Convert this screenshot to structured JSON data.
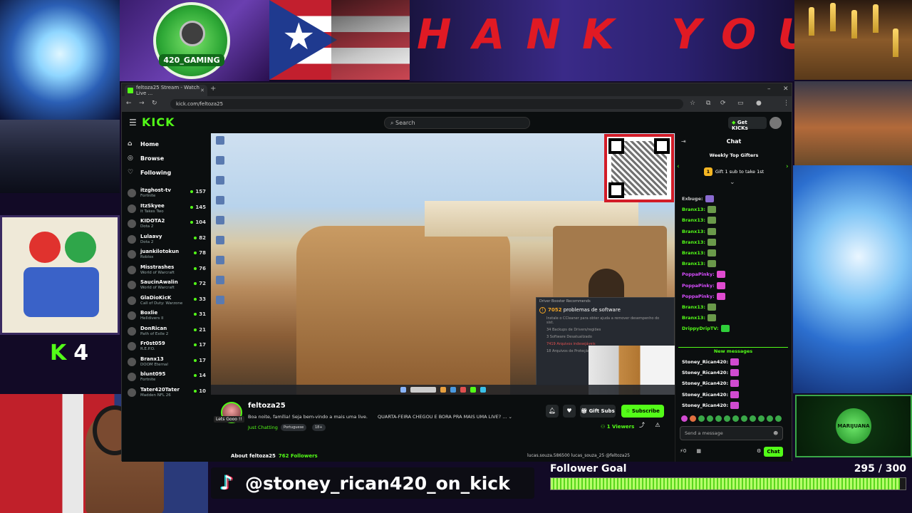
{
  "overlay": {
    "logo_text": "420_GAMING",
    "banner_text": "HANK YOU GUY",
    "kick_count_logo": "K",
    "kick_count": "4",
    "mj_text": "MARIJUANA",
    "tiktok_handle": "@stoney_rican420_on_kick",
    "follower_goal_label": "Follower Goal",
    "follower_goal_count": "295 / 300",
    "follower_goal_current": 295,
    "follower_goal_target": 300
  },
  "browser": {
    "tab_title": "feltoza25 Stream - Watch Live ...",
    "new_tab": "+",
    "url": "kick.com/feltoza25"
  },
  "kick": {
    "logo": "KICK",
    "search_placeholder": "Search",
    "get_kicks": "Get KICKs",
    "nav": [
      {
        "label": "Home",
        "icon": "home-icon"
      },
      {
        "label": "Browse",
        "icon": "browse-icon"
      },
      {
        "label": "Following",
        "icon": "heart-icon"
      }
    ],
    "following": [
      {
        "name": "itzghost-tv",
        "game": "Fortnite",
        "viewers": "157"
      },
      {
        "name": "ItzSkyee",
        "game": "It Takes Two",
        "viewers": "145"
      },
      {
        "name": "KIDOTA2",
        "game": "Dota 2",
        "viewers": "104"
      },
      {
        "name": "Lulaavy",
        "game": "Dota 2",
        "viewers": "82"
      },
      {
        "name": "juankilotokun",
        "game": "Roblox",
        "viewers": "78"
      },
      {
        "name": "Misstrashes",
        "game": "World of Warcraft",
        "viewers": "76"
      },
      {
        "name": "SaucinAwalin",
        "game": "World of Warcraft",
        "viewers": "72"
      },
      {
        "name": "GlaDioKicK",
        "game": "Call of Duty: Warzone",
        "viewers": "33"
      },
      {
        "name": "Boxlie",
        "game": "Helldivers II",
        "viewers": "31"
      },
      {
        "name": "DonRican",
        "game": "Path of Exile 2",
        "viewers": "21"
      },
      {
        "name": "Fr0st059",
        "game": "R.E.P.O.",
        "viewers": "17"
      },
      {
        "name": "Branx13",
        "game": "DOOM Eternal",
        "viewers": "17"
      },
      {
        "name": "blunt095",
        "game": "Fortnite",
        "viewers": "14"
      },
      {
        "name": "Tater420Tater",
        "game": "Madden NFL 26",
        "viewers": "10"
      }
    ],
    "popup": {
      "header": "Driver Booster Recommends",
      "title_count": "7052",
      "title_rest": "problemas de software",
      "subtitle": "Instale o CCleaner para obter ajuda a remover desempenho do sist.",
      "lines": [
        "34 Backups de Drivers/regiões",
        "3 Software Desatualizado",
        "7419 Arquivos indesejáveis",
        "18 Arquivos de Proteção"
      ]
    },
    "channel": {
      "lets_go": "Lets Gooo !!",
      "name": "feltoza25",
      "desc": "Boa noite, família! Seja bem-vindo a mais uma live.",
      "desc2": "QUARTA-FEIRA CHEGOU E BORA PRA MAIS UMA LIVE? ...",
      "category": "Just Chatting",
      "tags": [
        "Portuguese",
        "18+"
      ],
      "gift_subs": "Gift Subs",
      "subscribe": "Subscribe",
      "viewers": "1 Viewers",
      "about": "About feltoza25",
      "followers": "762 Followers",
      "socials": "lucas.souza.586500   lucas_souza_25   @feltoza25"
    },
    "chat": {
      "title": "Chat",
      "weekly": "Weekly Top Gifters",
      "gift1": "Gift 1 sub to take 1st",
      "gift1_rank": "1",
      "new_messages": "New messages",
      "input_placeholder": "Send a message",
      "send": "Chat",
      "balance": "0",
      "messages": [
        {
          "user": "Exbuge:",
          "color": "#c7c7c7",
          "emote": "#8a6ad0"
        },
        {
          "user": "Branx13:",
          "color": "#53fc18",
          "emote": "#6a9a4a"
        },
        {
          "user": "Branx13:",
          "color": "#53fc18",
          "emote": "#6a9a4a"
        },
        {
          "user": "Branx13:",
          "color": "#53fc18",
          "emote": "#6a9a4a"
        },
        {
          "user": "Branx13:",
          "color": "#53fc18",
          "emote": "#6a9a4a"
        },
        {
          "user": "Branx13:",
          "color": "#53fc18",
          "emote": "#6a9a4a"
        },
        {
          "user": "Branx13:",
          "color": "#53fc18",
          "emote": "#6a9a4a"
        },
        {
          "user": "PoppaPinky:",
          "color": "#d84dff",
          "emote": "#e04bd0"
        },
        {
          "user": "PoppaPinky:",
          "color": "#d84dff",
          "emote": "#e04bd0"
        },
        {
          "user": "PoppaPinky:",
          "color": "#d84dff",
          "emote": "#e04bd0"
        },
        {
          "user": "Branx13:",
          "color": "#53fc18",
          "emote": "#6a9a4a"
        },
        {
          "user": "Branx13:",
          "color": "#53fc18",
          "emote": "#6a9a4a"
        },
        {
          "user": "DrippyDripTV:",
          "color": "#53fc18",
          "emote": "#2fcf3a"
        }
      ],
      "new_list": [
        {
          "user": "Stoney_Rican420:",
          "color": "#ffffff",
          "emote": "#d04bd0"
        },
        {
          "user": "Stoney_Rican420:",
          "color": "#ffffff",
          "emote": "#d04bd0"
        },
        {
          "user": "Stoney_Rican420:",
          "color": "#ffffff",
          "emote": "#d04bd0"
        },
        {
          "user": "Stoney_Rican420:",
          "color": "#ffffff",
          "emote": "#d04bd0"
        },
        {
          "user": "Stoney_Rican420:",
          "color": "#ffffff",
          "emote": "#d04bd0"
        }
      ]
    }
  }
}
